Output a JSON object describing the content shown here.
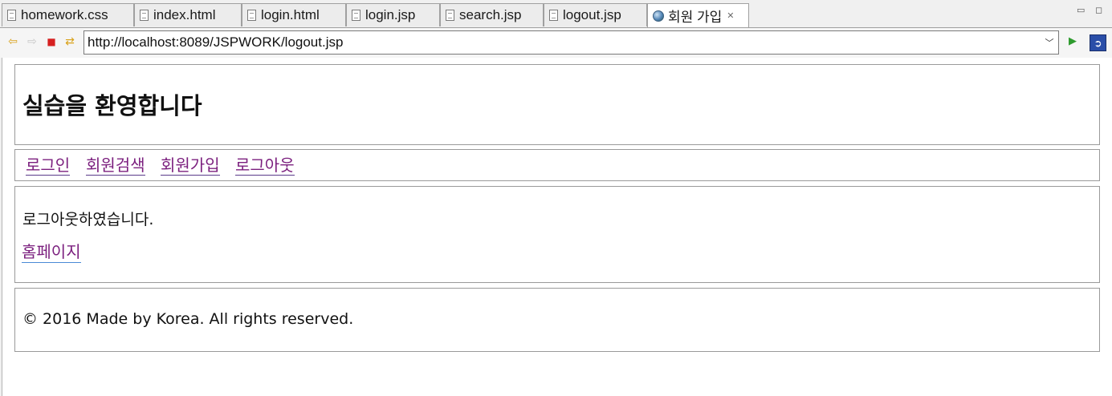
{
  "tabs": [
    {
      "label": "homework.css",
      "icon": "file-icon",
      "active": false
    },
    {
      "label": "index.html",
      "icon": "file-icon",
      "active": false
    },
    {
      "label": "login.html",
      "icon": "file-icon",
      "active": false
    },
    {
      "label": "login.jsp",
      "icon": "file-icon",
      "active": false
    },
    {
      "label": "search.jsp",
      "icon": "file-icon",
      "active": false
    },
    {
      "label": "logout.jsp",
      "icon": "file-icon",
      "active": false
    },
    {
      "label": "회원 가입",
      "icon": "globe-icon",
      "active": true
    }
  ],
  "toolbar": {
    "url": "http://localhost:8089/JSPWORK/logout.jsp"
  },
  "page": {
    "title": "실습을 환영합니다",
    "nav": [
      "로그인",
      "회원검색",
      "회원가입",
      "로그아웃"
    ],
    "message": "로그아웃하였습니다.",
    "home_link": "홈페이지",
    "footer": "© 2016 Made by Korea. All rights reserved."
  },
  "colors": {
    "link_visited": "#7b1f7e",
    "border": "#9a9a9a"
  }
}
